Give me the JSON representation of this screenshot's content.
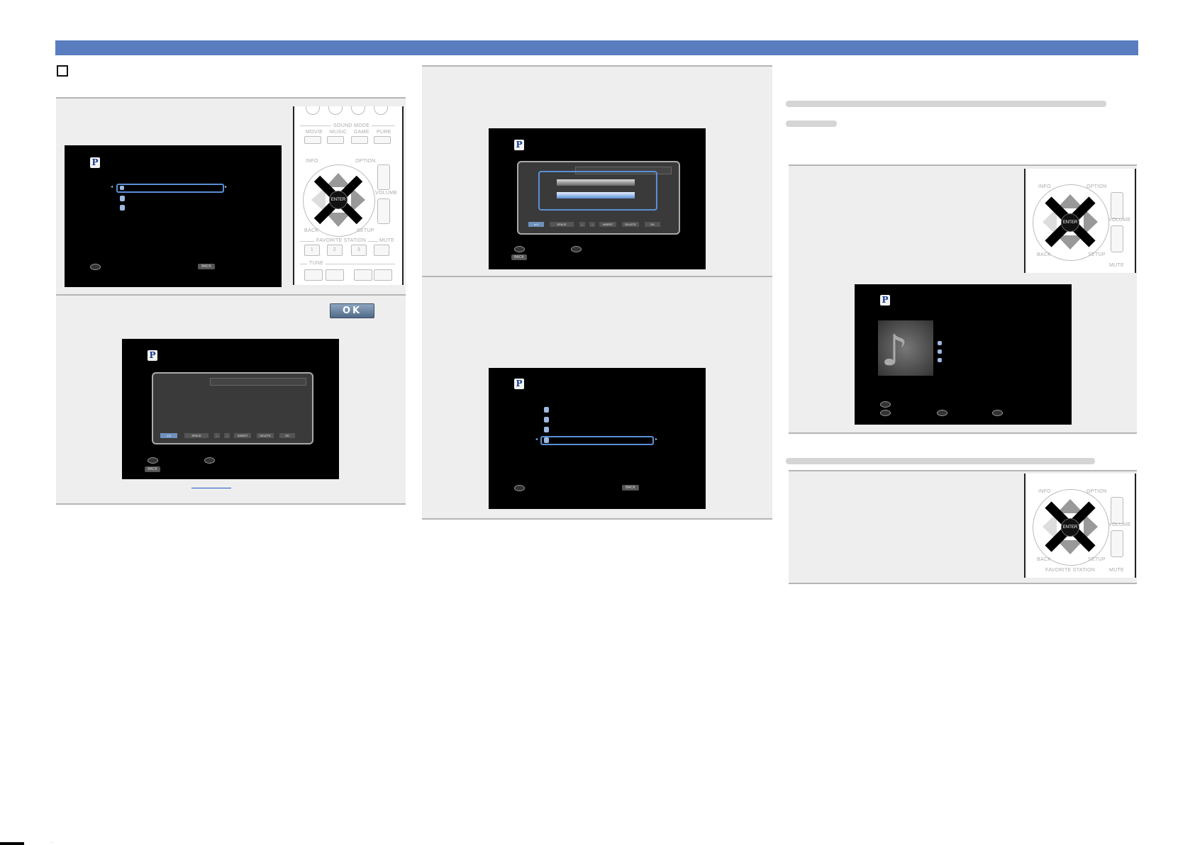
{
  "header": {
    "bar_color": "#5a7dc0"
  },
  "buttons": {
    "ok": "OK",
    "back": "BACK",
    "enter": "ENTER"
  },
  "keyboard": {
    "keys": [
      "a/A",
      "SPACE",
      "←",
      "→",
      "INSERT",
      "DELETE",
      "OK"
    ]
  },
  "remote": {
    "sound_mode": "SOUND MODE",
    "movie": "MOVIE",
    "music": "MUSIC",
    "game": "GAME",
    "pure": "PURE",
    "info": "INFO",
    "option": "OPTION",
    "back": "BACK",
    "setup": "SETUP",
    "volume": "VOLUME",
    "favorite_station": "FAVORITE STATION",
    "mute": "MUTE",
    "tune": "TUNE",
    "num1": "1",
    "num2": "2",
    "num3": "3"
  },
  "logo_letter": "P",
  "footer_text": "..."
}
